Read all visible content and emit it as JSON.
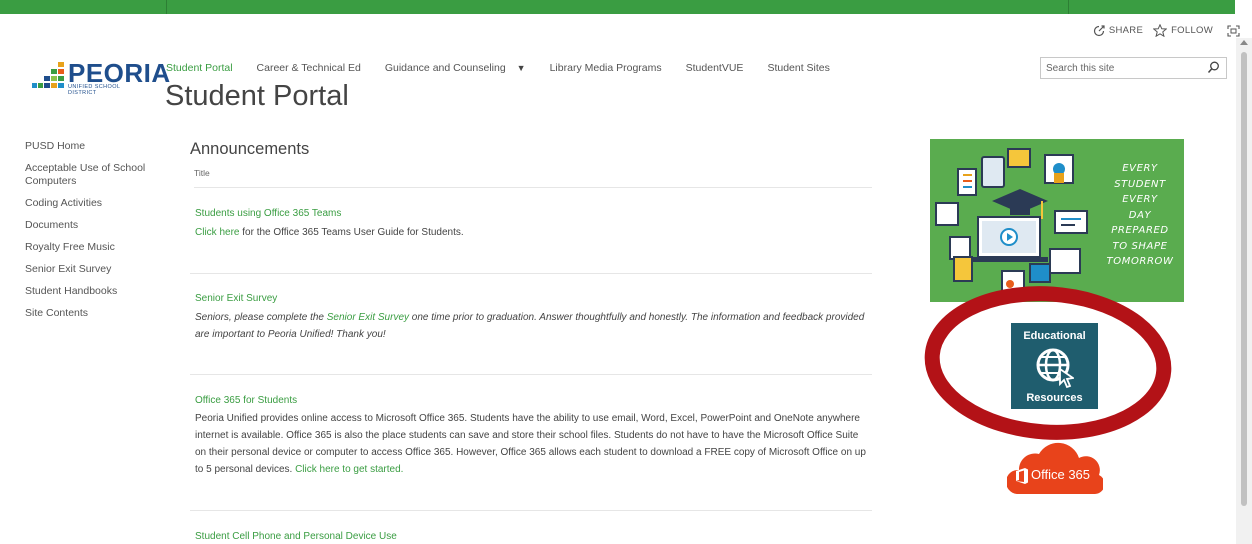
{
  "header": {
    "share_label": "SHARE",
    "follow_label": "FOLLOW"
  },
  "logo": {
    "name": "PEORIA",
    "subtitle": "UNIFIED SCHOOL DISTRICT"
  },
  "topnav": {
    "items": [
      {
        "label": "Student Portal"
      },
      {
        "label": "Career & Technical Ed"
      },
      {
        "label": "Guidance and Counseling"
      },
      {
        "label": "Library Media Programs"
      },
      {
        "label": "StudentVUE"
      },
      {
        "label": "Student Sites"
      }
    ]
  },
  "page": {
    "title": "Student Portal"
  },
  "search": {
    "placeholder": "Search this site"
  },
  "leftnav": {
    "items": [
      {
        "label": "PUSD Home"
      },
      {
        "label": "Acceptable Use of School Computers"
      },
      {
        "label": "Coding Activities"
      },
      {
        "label": "Documents"
      },
      {
        "label": "Royalty Free Music"
      },
      {
        "label": "Senior Exit Survey"
      },
      {
        "label": "Student Handbooks"
      },
      {
        "label": "Site Contents"
      }
    ]
  },
  "announcements": {
    "heading": "Announcements",
    "column_title": "Title",
    "items": [
      {
        "title": "Students using Office 365 Teams",
        "link_text": "Click here",
        "body": " for the Office 365 Teams User Guide for Students."
      },
      {
        "title": "Senior Exit Survey",
        "body_pre": "Seniors, please complete the ",
        "link_text": "Senior Exit Survey",
        "body_post": " one time prior to graduation.  Answer thoughtfully and honestly.  The information and feedback provided are important to Peoria Unified!  Thank you!"
      },
      {
        "title": "Office 365 for Students",
        "body": "Peoria Unified provides online access to Microsoft Office 365. Students have the ability to use email, Word, Excel, PowerPoint and OneNote anywhere internet is available. Office 365 is also the place students can save and store their school files.  Students do not have to have the Microsoft Office Suite on their personal device or computer to access Office 365. However, Office 365 allows each student to download a FREE copy of Microsoft Office on up to 5 personal devices.  ",
        "link_text": "Click here to get started."
      },
      {
        "title": "Student Cell Phone and Personal Device Use"
      }
    ]
  },
  "sidebar": {
    "banner_slogan": [
      "EVERY",
      "STUDENT",
      "EVERY",
      "DAY",
      "PREPARED",
      "TO SHAPE",
      "TOMORROW"
    ],
    "edu_line1": "Educational",
    "edu_line2": "Resources",
    "office_label": "Office 365"
  },
  "colors": {
    "brand_green": "#3a9d42",
    "brand_blue": "#1f4e8c",
    "edu_teal": "#1f5d6e",
    "office_orange": "#e8431b",
    "annotation_red": "#b31217"
  }
}
